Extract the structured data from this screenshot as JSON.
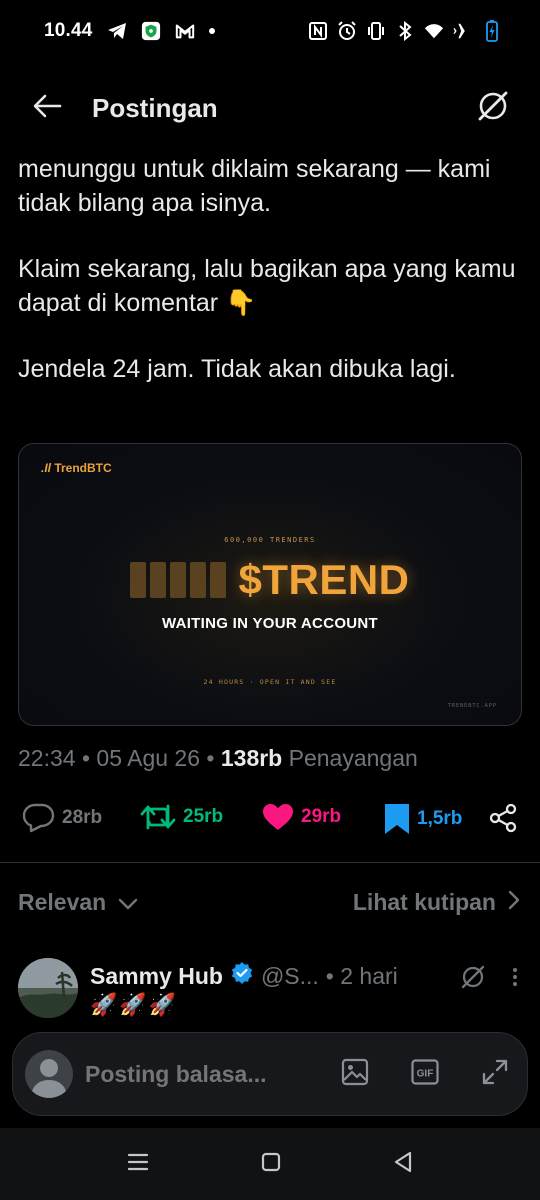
{
  "status_bar": {
    "time": "10.44",
    "left_icons": [
      "telegram-icon",
      "vpn-shield-icon",
      "gmail-icon",
      "notification-dot-icon"
    ],
    "right_icons": [
      "nfc-icon",
      "alarm-icon",
      "vibrate-icon",
      "bluetooth-icon",
      "wifi-icon",
      "airplane-icon",
      "battery-icon"
    ]
  },
  "header": {
    "title": "Postingan",
    "back_icon": "arrow-left-icon",
    "right_icon": "grok-icon"
  },
  "post": {
    "paragraphs": [
      "menunggu untuk diklaim sekarang — kami tidak bilang apa isinya.",
      "Klaim sekarang, lalu bagikan apa yang kamu dapat di komentar 👇",
      "Jendela 24 jam. Tidak akan dibuka lagi."
    ],
    "media": {
      "brand": "TrendBTC",
      "kicker": "600,000 TRENDERS",
      "ticker": "$TREND",
      "subtitle": "WAITING IN YOUR ACCOUNT",
      "footer": "24 HOURS · OPEN IT AND SEE",
      "url": "TRENDBTC.APP",
      "accent_color": "#f0a43a"
    },
    "meta": {
      "time": "22:34",
      "date": "05 Agu 26",
      "views_count": "138rb",
      "views_label": "Penayangan"
    },
    "actions": {
      "replies": "28rb",
      "reposts": "25rb",
      "likes": "29rb",
      "bookmarks": "1,5rb",
      "colors": {
        "reply": "#71767b",
        "repost": "#00ba7c",
        "like": "#f91880",
        "bookmark": "#1d9bf0"
      }
    }
  },
  "sort": {
    "left_label": "Relevan",
    "right_label": "Lihat kutipan"
  },
  "reply": {
    "name": "Sammy Hub",
    "handle": "@S...",
    "time": "• 2 hari",
    "body": "🚀🚀🚀"
  },
  "composer": {
    "placeholder": "Posting balasa...",
    "icons": [
      "image-icon",
      "gif-icon",
      "expand-icon"
    ]
  },
  "nav_bar": {
    "icons": [
      "recents-icon",
      "home-icon",
      "back-icon"
    ]
  }
}
